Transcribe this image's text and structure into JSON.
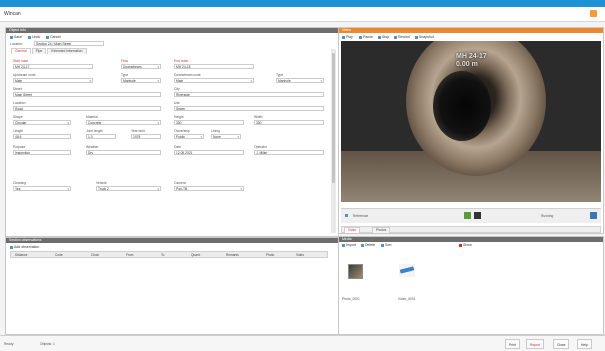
{
  "window": {
    "title": "Wincan"
  },
  "left_panel": {
    "header": "Object Info",
    "toolbar": [
      "Save",
      "Undo",
      "Cancel"
    ],
    "location": {
      "label": "Location",
      "value": "Section 24 / Main Street"
    },
    "tabs": [
      "General",
      "Pipe",
      "Extended information"
    ],
    "fields": [
      {
        "label": "Start node",
        "value": "MH 24-17",
        "red": true
      },
      {
        "label": "Flow",
        "value": "Downstream",
        "red": true
      },
      {
        "label": "End node",
        "value": "MH 24-18",
        "red": true
      },
      {
        "label": "Upstream node",
        "value": "Main"
      },
      {
        "label": "Type",
        "value": "Manhole"
      },
      {
        "label": "Downstream node",
        "value": "Main"
      },
      {
        "label": "Type",
        "value": "Manhole"
      },
      {
        "label": "Street",
        "value": "Main Street"
      },
      {
        "label": "City",
        "value": "Riverside"
      },
      {
        "label": "Location",
        "value": "Road"
      },
      {
        "label": "Use",
        "value": "Sewer"
      },
      {
        "label": "Shape",
        "value": "Circular"
      },
      {
        "label": "Material",
        "value": "Concrete"
      },
      {
        "label": "Height",
        "value": "300"
      },
      {
        "label": "Width",
        "value": "300"
      },
      {
        "label": "Length",
        "value": "48.6"
      },
      {
        "label": "Joint length",
        "value": "1.0"
      },
      {
        "label": "Year built",
        "value": "1978"
      },
      {
        "label": "Ownership",
        "value": "Public"
      },
      {
        "label": "Lining",
        "value": "None"
      },
      {
        "label": "Purpose",
        "value": "Inspection"
      },
      {
        "label": "Weather",
        "value": "Dry"
      },
      {
        "label": "Date",
        "value": "12.05.2021"
      },
      {
        "label": "Operator",
        "value": "J. Miller"
      },
      {
        "label": "Cleaning",
        "value": "Yes"
      },
      {
        "label": "Vehicle",
        "value": "Truck 2"
      },
      {
        "label": "Camera",
        "value": "Pan-Tilt"
      }
    ],
    "observations_header": "Section observations",
    "grid_toolbar": "Add observation",
    "grid_columns": [
      "Distance",
      "Code",
      "Clock",
      "From",
      "To",
      "Quant.",
      "Remarks",
      "Photo",
      "Video"
    ]
  },
  "right_panel": {
    "header": "Video",
    "video_toolbar": [
      "Play",
      "Pause",
      "Stop",
      "Rewind",
      "Snapshot"
    ],
    "overlay_lines": [
      "MH 24-17",
      "0.00 m"
    ],
    "controls": {
      "label": "Reference",
      "status": "Running"
    },
    "media_tabs": [
      "Video",
      "Photos"
    ],
    "media_header": "Media",
    "media_toolbar": [
      "Import",
      "Delete",
      "Sort",
      "Show"
    ],
    "media_items": [
      {
        "label": "Photo_0001",
        "icon": "photo-thumbnail-icon"
      },
      {
        "label": "Video_0001",
        "icon": "pen-icon"
      }
    ]
  },
  "statusbar": {
    "left": [
      "Ready",
      "Objects: 1"
    ],
    "buttons": [
      "Print",
      "Report",
      "Close",
      "Help"
    ]
  }
}
